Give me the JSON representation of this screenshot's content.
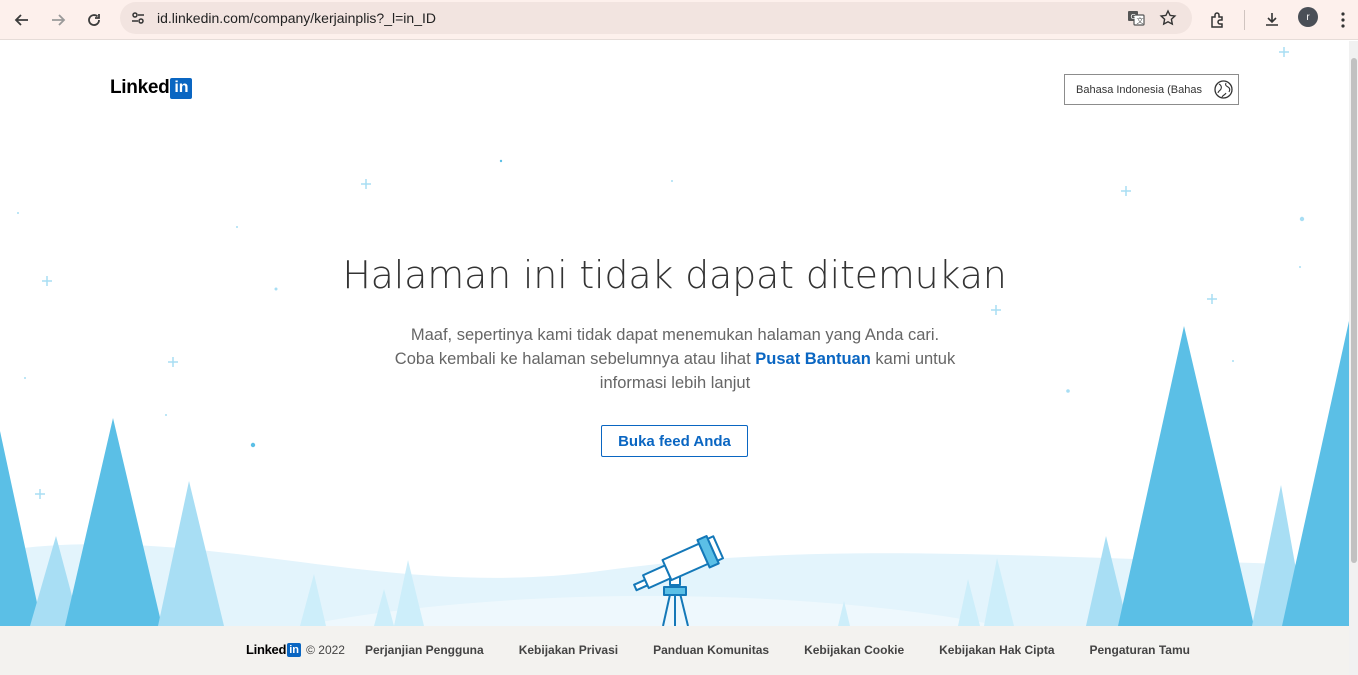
{
  "browser": {
    "url": "id.linkedin.com/company/kerjainplis?_l=in_ID",
    "profile_initial": "r"
  },
  "header": {
    "logo_word": "Linked",
    "logo_in": "in",
    "language_label": "Bahasa Indonesia (Bahas"
  },
  "main": {
    "title": "Halaman ini tidak dapat ditemukan",
    "description_before_link": "Maaf, sepertinya kami tidak dapat menemukan halaman yang Anda cari. Coba kembali ke halaman sebelumnya atau lihat",
    "help_link": "Pusat Bantuan",
    "description_after_link": "kami untuk informasi lebih lanjut",
    "feed_button": "Buka feed Anda"
  },
  "footer": {
    "logo_word": "Linked",
    "logo_in": "in",
    "copyright": "© 2022",
    "links": [
      "Perjanjian Pengguna",
      "Kebijakan Privasi",
      "Panduan Komunitas",
      "Kebijakan Cookie",
      "Kebijakan Hak Cipta",
      "Pengaturan Tamu"
    ]
  },
  "colors": {
    "brand": "#0a66c2",
    "tree_dark": "#5bbfe6",
    "tree_light": "#a8def4",
    "snow": "#e3f4fc"
  }
}
